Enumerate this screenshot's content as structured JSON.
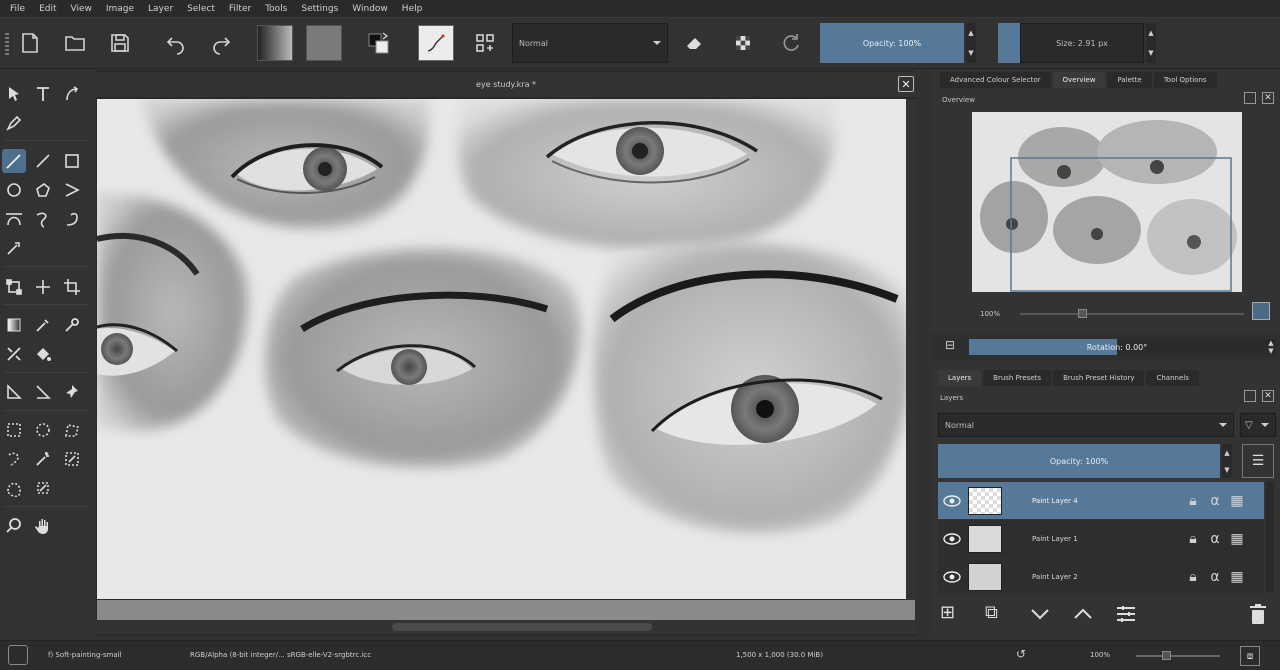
{
  "menu": [
    "File",
    "Edit",
    "View",
    "Image",
    "Layer",
    "Select",
    "Filter",
    "Tools",
    "Settings",
    "Window",
    "Help"
  ],
  "toolbar": {
    "blend_mode": "Normal",
    "opacity_label": "Opacity: 100%",
    "size_label": "Size: 2.91 px"
  },
  "document": {
    "title": "eye study.kra *"
  },
  "dockers": {
    "top_tabs": [
      "Advanced Colour Selector",
      "Overview",
      "Palette",
      "Tool Options"
    ],
    "overview_title": "Overview",
    "zoom_label": "100%",
    "rotation_label": "Rotation: 0.00°",
    "bottom_tabs": [
      "Layers",
      "Brush Presets",
      "Brush Preset History",
      "Channels"
    ],
    "layers_title": "Layers",
    "layers_blend": "Normal",
    "layers_opacity": "Opacity:  100%",
    "layers": [
      {
        "name": "Paint Layer 4",
        "selected": true
      },
      {
        "name": "Paint Layer 1",
        "selected": false
      },
      {
        "name": "Paint Layer 2",
        "selected": false
      }
    ]
  },
  "status": {
    "brush": "f) Soft-painting-small",
    "color_space": "RGB/Alpha (8-bit integer/... sRGB-elle-V2-srgbtrc.icc",
    "dimensions": "1,500 x 1,000 (30.0 MiB)",
    "zoom": "100%"
  },
  "colors": {
    "accent": "#56799a",
    "selected_layer": "#56799a",
    "background": "#313131"
  }
}
